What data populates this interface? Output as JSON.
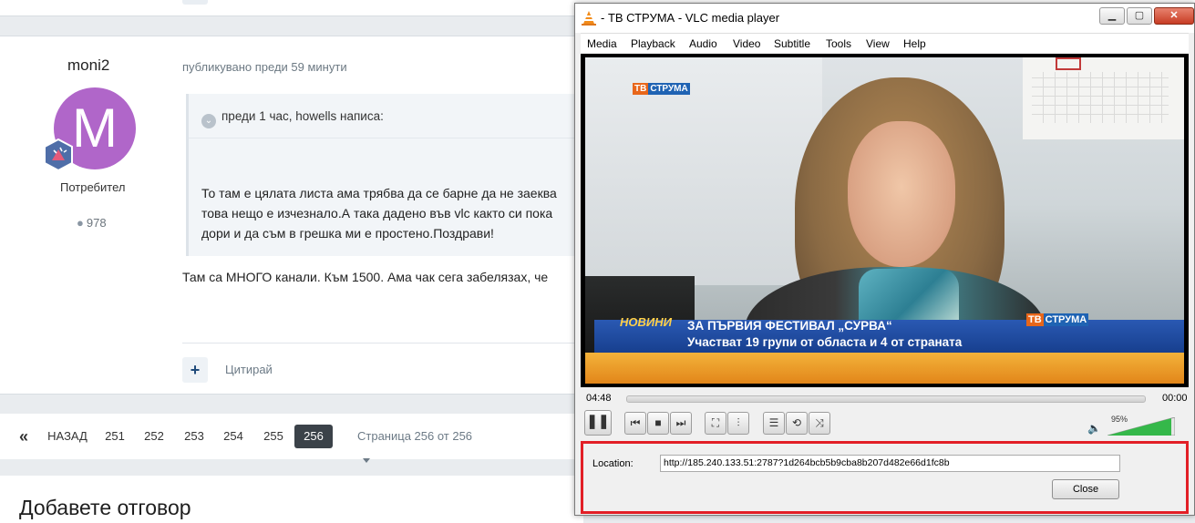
{
  "forum": {
    "author": {
      "name": "moni2",
      "avatar_letter": "M",
      "avatar_color": "#b066c9",
      "role": "Потребител",
      "post_count": "978"
    },
    "post": {
      "posted_time": "публикувано преди 59 минути",
      "quote_header": "преди 1 час, howells написа:",
      "quote_lines": [
        "То там е цялата листа ама трябва да се барне да не заеква",
        "това нещо е изчезнало.А така дадено във vlc както си пока",
        "дори и да съм в грешка ми е простено.Поздрави!"
      ],
      "body": "Там са МНОГО канали. Към 1500. Ама чак сега забелязах, че"
    },
    "actions": {
      "plus_label": "+",
      "quote_label": "Цитирай"
    },
    "pagination": {
      "prev_symbol": "«",
      "back_label": "НАЗАД",
      "pages": [
        "251",
        "252",
        "253",
        "254",
        "255",
        "256"
      ],
      "current": "256",
      "info": "Страница 256 от 256"
    },
    "reply_title": "Добавете отговор"
  },
  "vlc": {
    "title": " - ТВ СТРУМА - VLC media player",
    "menu": [
      "Media",
      "Playback",
      "Audio",
      "Video",
      "Subtitle",
      "Tools",
      "View",
      "Help"
    ],
    "video": {
      "logo_tv": "ТВ",
      "logo_name": "СТРУМА",
      "ticker_tag": "НОВИНИ",
      "ticker_line1": "ЗА ПЪРВИЯ ФЕСТИВАЛ „СУРВА“",
      "ticker_line2": "Участват 19 групи от областа и 4 от страната"
    },
    "time_elapsed": "04:48",
    "time_total": "00:00",
    "volume": "95%",
    "location_label": "Location:",
    "location_url": "http://185.240.133.51:2787?1d264bcb5b9cba8b207d482e66d1fc8b",
    "close_label": "Close"
  },
  "colors": {
    "highlight_border": "#e21f26",
    "active_page": "#3b4249",
    "link_accent": "#1f4a7a"
  }
}
